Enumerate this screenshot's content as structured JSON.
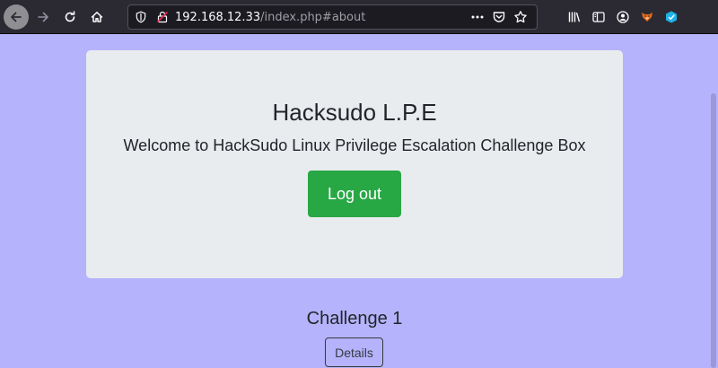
{
  "browser": {
    "url_host": "192.168.12.33",
    "url_path": "/index.php#about",
    "icons": [
      "back-icon",
      "forward-icon",
      "reload-icon",
      "home-icon",
      "tracking-shield-icon",
      "insecure-lock-icon",
      "page-actions-icon",
      "pocket-icon",
      "bookmark-star-icon",
      "library-icon",
      "sidebar-icon",
      "account-icon",
      "extension-fox-icon",
      "extension-cube-icon"
    ]
  },
  "jumbotron": {
    "title": "Hacksudo L.P.E",
    "lead": "Welcome to HackSudo Linux Privilege Escalation Challenge Box",
    "logout_label": "Log out"
  },
  "challenge": {
    "title": "Challenge 1",
    "details_label": "Details"
  },
  "colors": {
    "page_background": "#b5b3fb",
    "jumbotron_background": "#e9ecef",
    "logout_button": "#28a745",
    "toolbar": "#2b2a33"
  }
}
